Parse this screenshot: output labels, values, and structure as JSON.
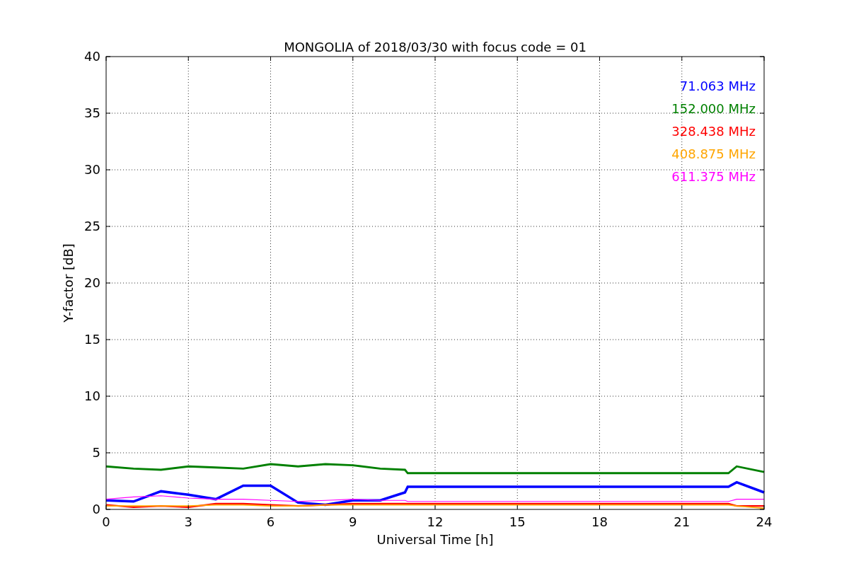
{
  "chart_data": {
    "type": "line",
    "title": "MONGOLIA of 2018/03/30 with focus code = 01",
    "xlabel": "Universal Time [h]",
    "ylabel": "Y-factor [dB]",
    "x": [
      0,
      1,
      2,
      3,
      4,
      5,
      6,
      7,
      8,
      9,
      10,
      10.9,
      11,
      22.7,
      23,
      24
    ],
    "series": [
      {
        "name": "71.063 MHz",
        "color": "#0000ff",
        "values": [
          0.8,
          0.7,
          1.6,
          1.3,
          0.9,
          2.1,
          2.1,
          0.6,
          0.4,
          0.8,
          0.8,
          1.5,
          2.0,
          2.0,
          2.4,
          1.5
        ]
      },
      {
        "name": "152.000 MHz",
        "color": "#008000",
        "values": [
          3.8,
          3.6,
          3.5,
          3.8,
          3.7,
          3.6,
          4.0,
          3.8,
          4.0,
          3.9,
          3.6,
          3.5,
          3.2,
          3.2,
          3.8,
          3.3
        ]
      },
      {
        "name": "328.438 MHz",
        "color": "#ff0000",
        "values": [
          0.4,
          0.2,
          0.3,
          0.2,
          0.5,
          0.5,
          0.4,
          0.3,
          0.4,
          0.5,
          0.5,
          0.5,
          0.5,
          0.5,
          0.3,
          0.3
        ]
      },
      {
        "name": "408.875 MHz",
        "color": "#ffa500",
        "values": [
          0.3,
          0.3,
          0.3,
          0.3,
          0.4,
          0.4,
          0.3,
          0.3,
          0.4,
          0.4,
          0.4,
          0.4,
          0.4,
          0.4,
          0.3,
          0.1
        ]
      },
      {
        "name": "611.375 MHz",
        "color": "#ff00ff",
        "values": [
          0.9,
          1.1,
          1.2,
          1.0,
          0.9,
          0.9,
          0.8,
          0.7,
          0.8,
          0.9,
          0.8,
          0.8,
          0.7,
          0.7,
          0.9,
          0.9
        ]
      }
    ],
    "xlim": [
      0,
      24
    ],
    "ylim": [
      0,
      40
    ],
    "xticks": [
      0,
      3,
      6,
      9,
      12,
      15,
      18,
      21,
      24
    ],
    "yticks": [
      0,
      5,
      10,
      15,
      20,
      25,
      30,
      35,
      40
    ],
    "grid": true
  }
}
